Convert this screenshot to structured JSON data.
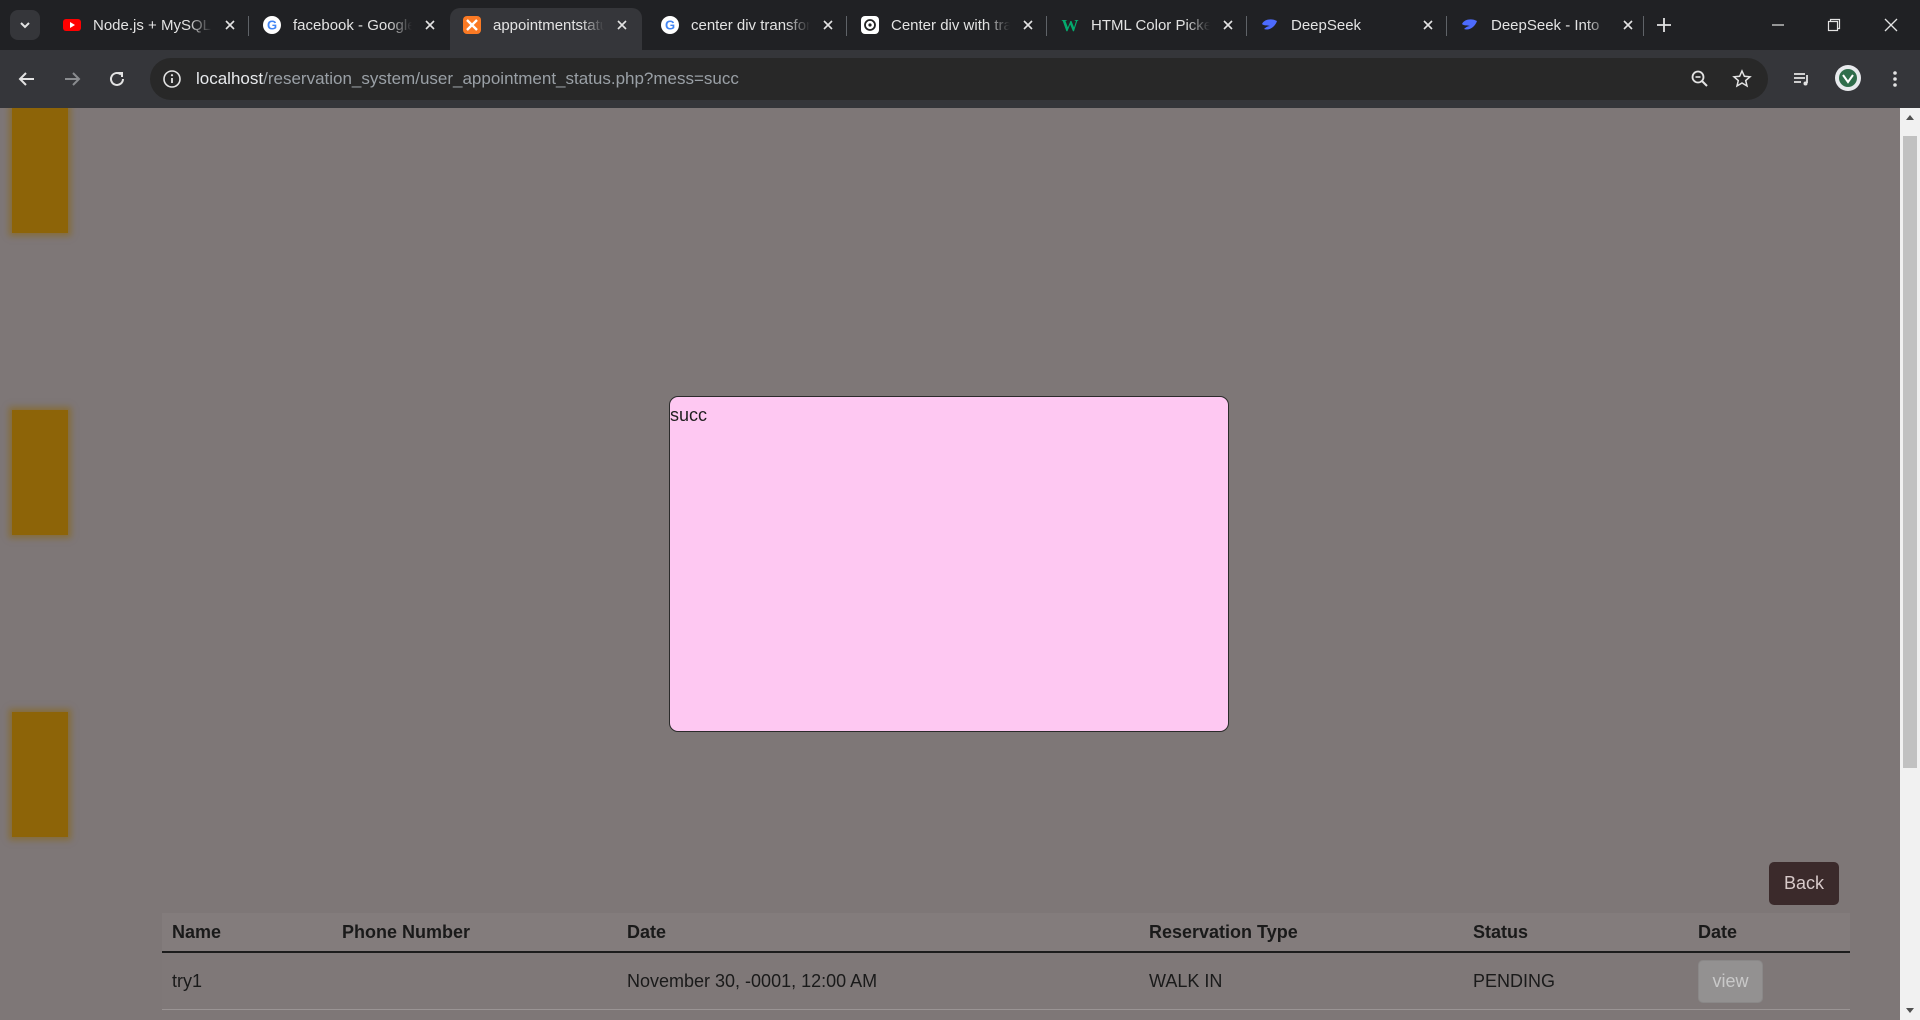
{
  "tabs": [
    {
      "title": "Node.js + MySQL",
      "icon": "youtube-icon"
    },
    {
      "title": "facebook - Google Search",
      "icon": "google-icon"
    },
    {
      "title": "appointmentstatus",
      "icon": "xampp-icon",
      "active": true
    },
    {
      "title": "center div transform",
      "icon": "google-icon"
    },
    {
      "title": "Center div with transform",
      "icon": "chatgpt-icon"
    },
    {
      "title": "HTML Color Picker",
      "icon": "w3schools-icon"
    },
    {
      "title": "DeepSeek",
      "icon": "deepseek-icon"
    },
    {
      "title": "DeepSeek - Into",
      "icon": "deepseek-icon"
    }
  ],
  "address_bar": {
    "host": "localhost",
    "path": "/reservation_system/user_appointment_status.php?mess=succ"
  },
  "modal": {
    "message": "succ",
    "background": "#fec8f2"
  },
  "back_button": {
    "label": "Back"
  },
  "table": {
    "headers": [
      "Name",
      "Phone Number",
      "Date",
      "Reservation Type",
      "Status",
      "Date"
    ],
    "rows": [
      {
        "name": "try1",
        "phone": "",
        "date": "November 30, -0001, 12:00 AM",
        "reservation_type": "WALK IN",
        "status": "PENDING",
        "action_label": "view"
      }
    ]
  },
  "colors": {
    "page_background": "#7e7777",
    "side_strip": "#8d6408",
    "back_button": "#3b2a2b"
  }
}
